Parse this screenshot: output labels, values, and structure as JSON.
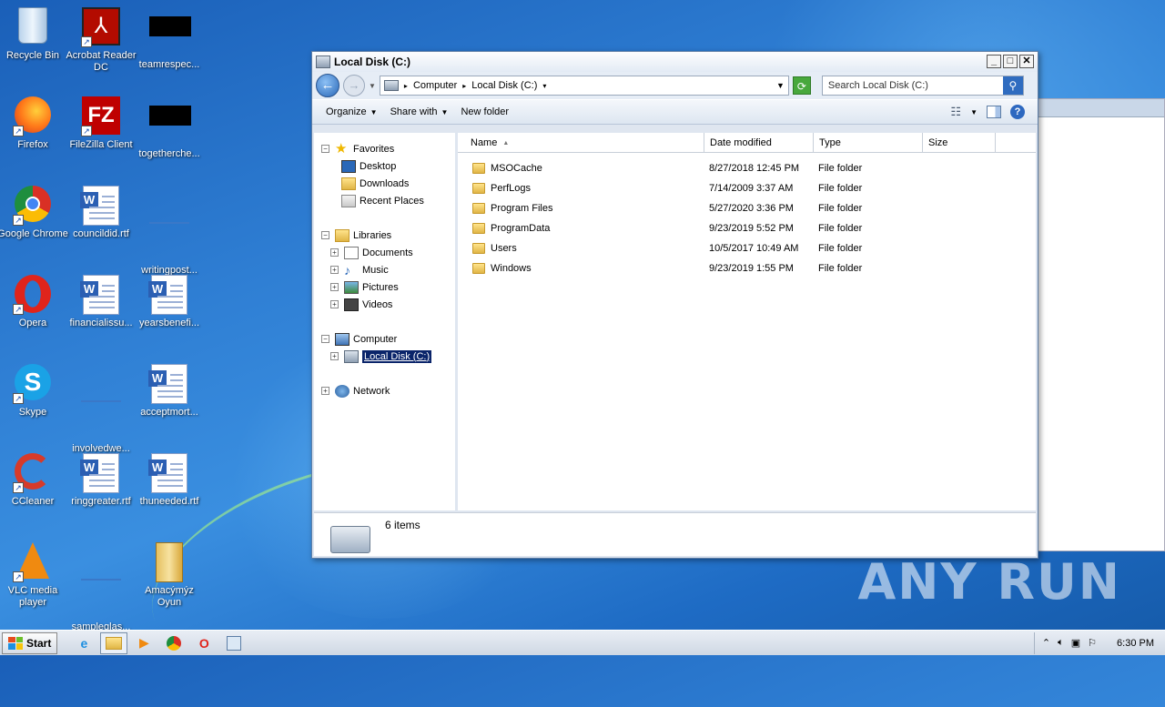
{
  "desktop": {
    "icons": [
      {
        "label": "Recycle Bin"
      },
      {
        "label": "Acrobat Reader DC"
      },
      {
        "label": "teamrespec..."
      },
      {
        "label": "Firefox"
      },
      {
        "label": "FileZilla Client"
      },
      {
        "label": "togetherche..."
      },
      {
        "label": "Google Chrome"
      },
      {
        "label": "councildid.rtf"
      },
      {
        "label": "writingpost..."
      },
      {
        "label": "Opera"
      },
      {
        "label": "financialissu..."
      },
      {
        "label": "yearsbenefi..."
      },
      {
        "label": "Skype"
      },
      {
        "label": "involvedwe..."
      },
      {
        "label": "acceptmort..."
      },
      {
        "label": "CCleaner"
      },
      {
        "label": "ringgreater.rtf"
      },
      {
        "label": "thuneeded.rtf"
      },
      {
        "label": "VLC media player"
      },
      {
        "label": "sampleglas..."
      },
      {
        "label": "Amacýmýz Oyun"
      }
    ],
    "watermark": "ANY RUN"
  },
  "window": {
    "title": "Local Disk (C:)",
    "breadcrumb": [
      "Computer",
      "Local Disk (C:)"
    ],
    "search_placeholder": "Search Local Disk (C:)",
    "toolbar": {
      "organize": "Organize",
      "share": "Share with",
      "new_folder": "New folder"
    },
    "tree": {
      "favorites": "Favorites",
      "desktop": "Desktop",
      "downloads": "Downloads",
      "recent": "Recent Places",
      "libraries": "Libraries",
      "documents": "Documents",
      "music": "Music",
      "pictures": "Pictures",
      "videos": "Videos",
      "computer": "Computer",
      "local_disk": "Local Disk (C:)",
      "network": "Network"
    },
    "columns": {
      "name": "Name",
      "date": "Date modified",
      "type": "Type",
      "size": "Size"
    },
    "files": [
      {
        "name": "MSOCache",
        "date": "8/27/2018 12:45 PM",
        "type": "File folder"
      },
      {
        "name": "PerfLogs",
        "date": "7/14/2009 3:37 AM",
        "type": "File folder"
      },
      {
        "name": "Program Files",
        "date": "5/27/2020 3:36 PM",
        "type": "File folder"
      },
      {
        "name": "ProgramData",
        "date": "9/23/2019 5:52 PM",
        "type": "File folder"
      },
      {
        "name": "Users",
        "date": "10/5/2017 10:49 AM",
        "type": "File folder"
      },
      {
        "name": "Windows",
        "date": "9/23/2019 1:55 PM",
        "type": "File folder"
      }
    ],
    "status": "6 items"
  },
  "taskbar": {
    "start": "Start",
    "clock": "6:30 PM"
  }
}
